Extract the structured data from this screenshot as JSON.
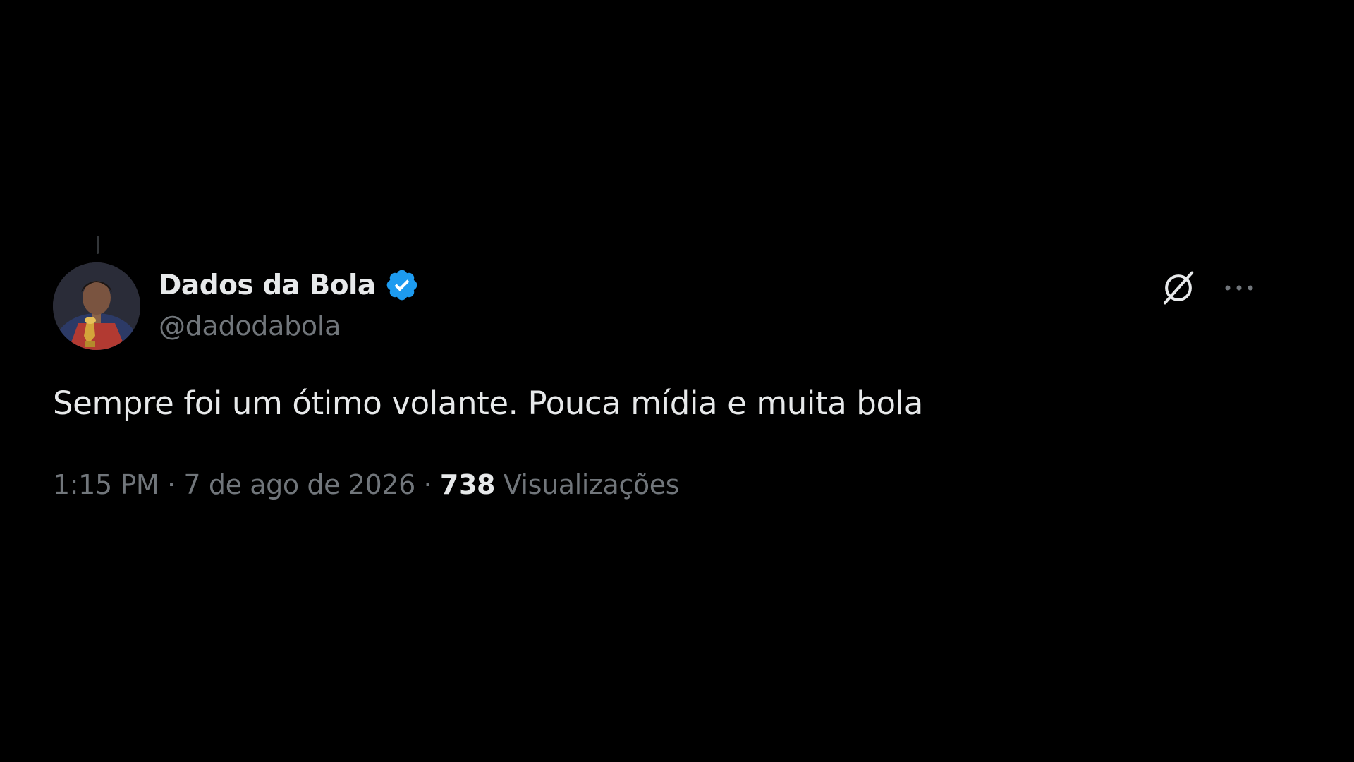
{
  "tweet": {
    "display_name": "Dados da Bola",
    "handle": "@dadodabola",
    "verified": true,
    "text": "Sempre foi um ótimo volante. Pouca mídia e muita bola",
    "time": "1:15 PM",
    "separator": "·",
    "date": "7 de ago de 2026",
    "views_count": "738",
    "views_label": "Visualizações"
  },
  "icons": {
    "verified": "verified-badge-icon",
    "grok": "grok-icon",
    "more": "more-options-icon"
  },
  "colors": {
    "background": "#000000",
    "primary_text": "#e7e9ea",
    "secondary_text": "#71767b",
    "verified_blue": "#1d9bf0"
  }
}
